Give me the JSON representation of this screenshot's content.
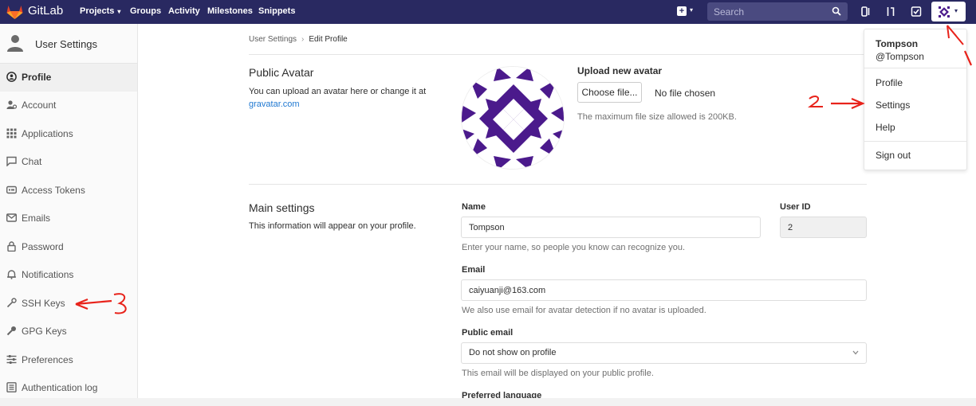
{
  "navbar": {
    "brand": "GitLab",
    "links": [
      {
        "label": "Projects",
        "has_caret": true
      },
      {
        "label": "Groups"
      },
      {
        "label": "Activity"
      },
      {
        "label": "Milestones"
      },
      {
        "label": "Snippets"
      }
    ],
    "search_placeholder": "Search"
  },
  "sidebar": {
    "title": "User Settings",
    "items": [
      {
        "label": "Profile",
        "icon": "profile-icon",
        "active": true
      },
      {
        "label": "Account",
        "icon": "account-icon"
      },
      {
        "label": "Applications",
        "icon": "applications-icon"
      },
      {
        "label": "Chat",
        "icon": "chat-icon"
      },
      {
        "label": "Access Tokens",
        "icon": "access-tokens-icon"
      },
      {
        "label": "Emails",
        "icon": "emails-icon"
      },
      {
        "label": "Password",
        "icon": "password-icon"
      },
      {
        "label": "Notifications",
        "icon": "notifications-icon"
      },
      {
        "label": "SSH Keys",
        "icon": "ssh-keys-icon"
      },
      {
        "label": "GPG Keys",
        "icon": "gpg-keys-icon"
      },
      {
        "label": "Preferences",
        "icon": "preferences-icon"
      },
      {
        "label": "Authentication log",
        "icon": "authentication-log-icon"
      }
    ]
  },
  "breadcrumb": {
    "parent": "User Settings",
    "current": "Edit Profile"
  },
  "avatar_section": {
    "title": "Public Avatar",
    "desc": "You can upload an avatar here or change it at",
    "link": "gravatar.com",
    "upload_label": "Upload new avatar",
    "choose_button": "Choose file...",
    "no_file": "No file chosen",
    "max_size": "The maximum file size allowed is 200KB."
  },
  "main_settings": {
    "title": "Main settings",
    "desc": "This information will appear on your profile.",
    "name_label": "Name",
    "name_value": "Tompson",
    "name_help": "Enter your name, so people you know can recognize you.",
    "user_id_label": "User ID",
    "user_id_value": "2",
    "email_label": "Email",
    "email_value": "caiyuanji@163.com",
    "email_help": "We also use email for avatar detection if no avatar is uploaded.",
    "public_email_label": "Public email",
    "public_email_value": "Do not show on profile",
    "public_email_help": "This email will be displayed on your public profile.",
    "preferred_language_label": "Preferred language"
  },
  "dropdown": {
    "name": "Tompson",
    "handle": "@Tompson",
    "items": [
      "Profile",
      "Settings",
      "Help"
    ],
    "sign_out": "Sign out"
  },
  "annotations": [
    "1",
    "2",
    "3"
  ],
  "colors": {
    "navbar": "#292961",
    "avatar": "#4b1a8c",
    "link": "#1f78d1",
    "annotation": "#e8231b"
  }
}
